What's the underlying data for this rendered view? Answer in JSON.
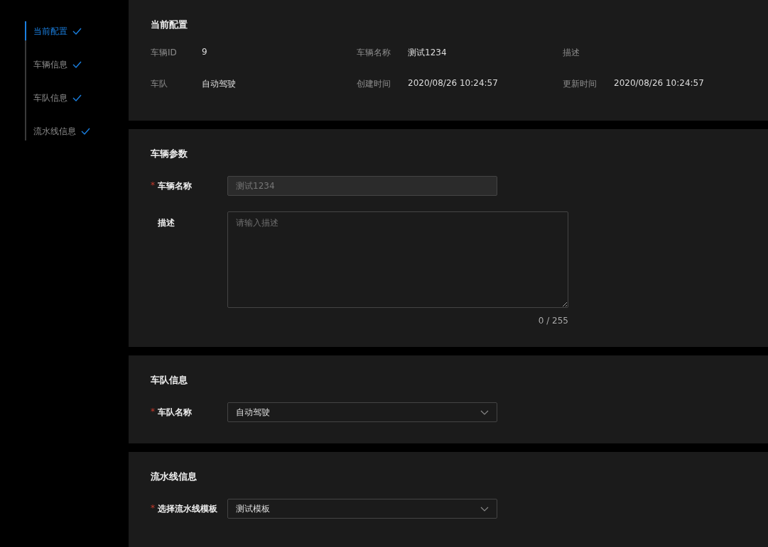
{
  "sidebar": {
    "items": [
      {
        "label": "当前配置",
        "selected": true,
        "checked": true
      },
      {
        "label": "车辆信息",
        "selected": false,
        "checked": true
      },
      {
        "label": "车队信息",
        "selected": false,
        "checked": true
      },
      {
        "label": "流水线信息",
        "selected": false,
        "checked": true
      }
    ]
  },
  "current_config": {
    "title": "当前配置",
    "rows": [
      [
        {
          "label": "车辆ID",
          "value": "9"
        },
        {
          "label": "车辆名称",
          "value": "测试1234"
        },
        {
          "label": "描述"
        }
      ],
      [
        {
          "label": "车队",
          "value": "自动驾驶"
        },
        {
          "label": "创建时间",
          "value": "2020/08/26 10:24:57"
        },
        {
          "label": "更新时间",
          "value": "2020/08/26 10:24:57"
        }
      ]
    ]
  },
  "sections": [
    {
      "title": "车辆参数",
      "fields": [
        {
          "kind": "input",
          "label": "车辆名称",
          "required_mark": "*",
          "disabled": true,
          "value": "测试1234"
        },
        {
          "kind": "textarea",
          "label": "描述",
          "placeholder": "请输入描述",
          "counter": "0 / 255"
        }
      ]
    },
    {
      "title": "车队信息",
      "fields": [
        {
          "kind": "select",
          "label": "车队名称",
          "required_mark": "*",
          "value": "自动驾驶"
        }
      ]
    },
    {
      "title": "流水线信息",
      "fields": [
        {
          "kind": "select",
          "label": "选择流水线模板",
          "required_mark": "*",
          "value": "测试模板"
        }
      ]
    }
  ]
}
